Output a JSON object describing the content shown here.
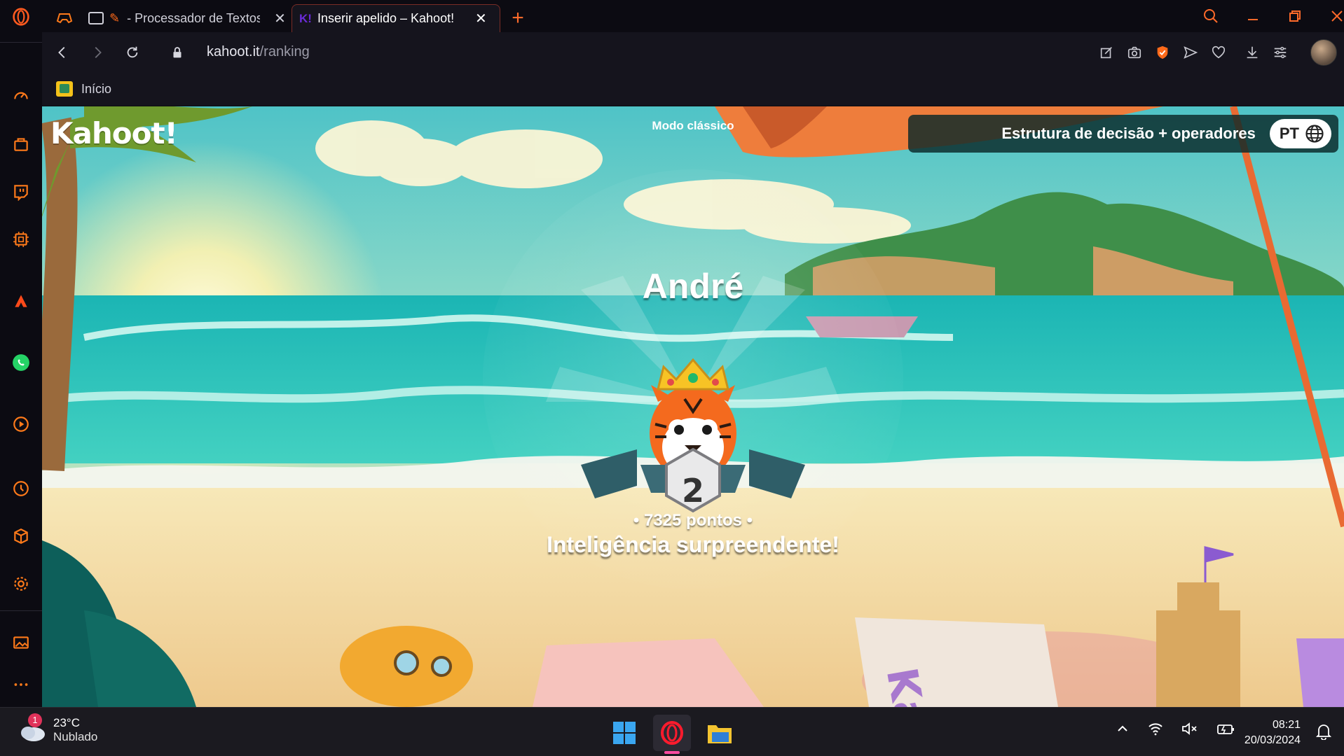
{
  "browser": {
    "tabs": [
      {
        "title": "- Processador de Textos",
        "active": false
      },
      {
        "title": "Inserir apelido – Kahoot!",
        "active": true
      }
    ],
    "favicon_kahoot": "K!",
    "url_host": "kahoot.it",
    "url_path": "/ranking",
    "bookmark_home": "Início"
  },
  "kahoot": {
    "logo": "Kahoot!",
    "mode": "Modo clássico",
    "quiz_title": "Estrutura de decisão + operadores",
    "language": "PT",
    "player_name": "André",
    "rank": "2",
    "points": "• 7325 pontos •",
    "message": "Inteligência surpreendente!"
  },
  "taskbar": {
    "weather_temp": "23°C",
    "weather_cond": "Nublado",
    "weather_badge": "1",
    "time": "08:21",
    "date": "20/03/2024"
  },
  "colors": {
    "opera_red": "#ff1b2d",
    "accent_orange": "#ff7a1a",
    "whatsapp_green": "#25d366"
  }
}
